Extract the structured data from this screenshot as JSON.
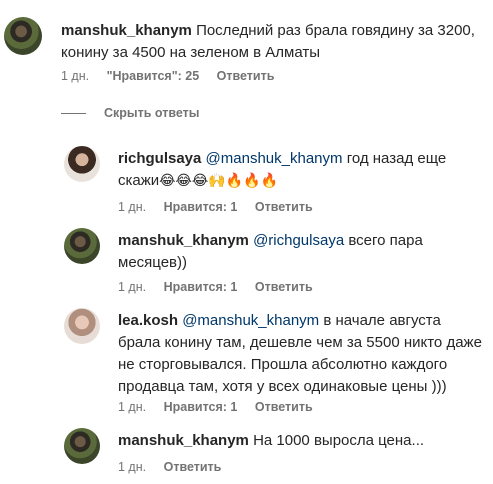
{
  "comments": [
    {
      "user": "manshuk_khanym",
      "mention": "",
      "text": "Последний раз брала говядину за 3200, конину за 4500 на зеленом в Алматы",
      "time": "1 дн.",
      "likes": "\"Нравится\": 25",
      "reply": "Ответить"
    },
    {
      "user": "richgulsaya",
      "mention": "@manshuk_khanym",
      "text": "год назад еще скажи",
      "emoji": "😂😂😂🙌🔥🔥🔥",
      "time": "1 дн.",
      "likes": "Нравится: 1",
      "reply": "Ответить"
    },
    {
      "user": "manshuk_khanym",
      "mention": "@richgulsaya",
      "text": "всего пара месяцев))",
      "time": "1 дн.",
      "likes": "Нравится: 1",
      "reply": "Ответить"
    },
    {
      "user": "lea.kosh",
      "mention": "@manshuk_khanym",
      "text": "в начале августа брала конину там, дешевле чем за 5500 никто даже не сторговывался. Прошла абсолютно каждого продавца там, хотя у всех одинаковые цены )))",
      "time": "1 дн.",
      "likes": "Нравится: 1",
      "reply": "Ответить"
    },
    {
      "user": "manshuk_khanym",
      "mention": "",
      "text": "На 1000 выросла цена...",
      "time": "1 дн.",
      "reply": "Ответить"
    }
  ],
  "hide_replies": "Скрыть ответы"
}
